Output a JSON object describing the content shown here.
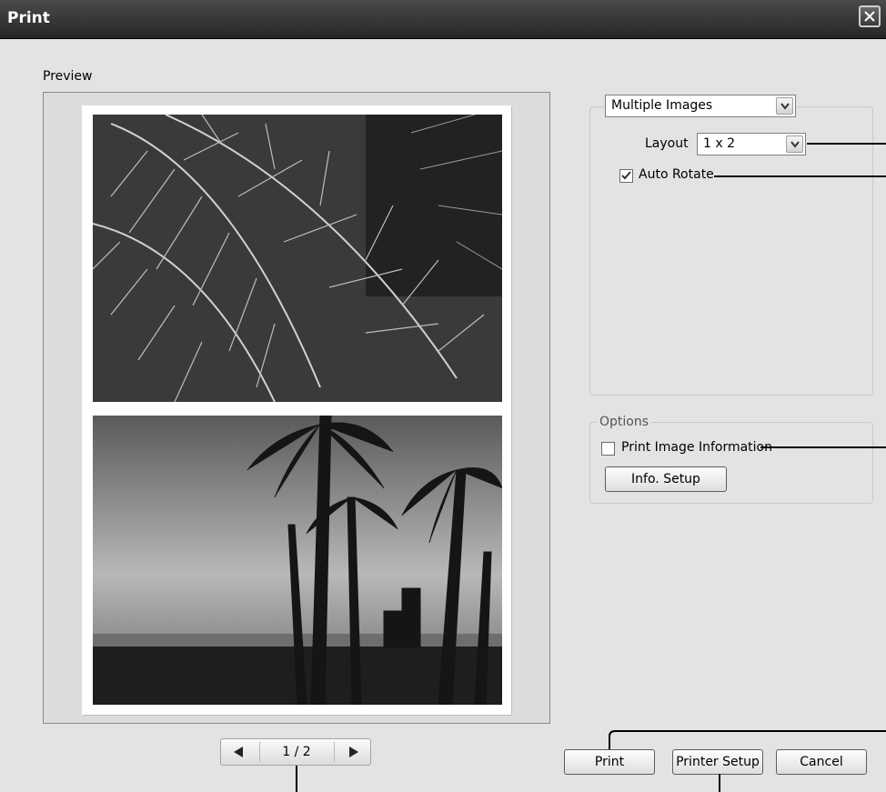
{
  "window": {
    "title": "Print"
  },
  "preview": {
    "label": "Preview"
  },
  "print_mode": {
    "selected": "Multiple Images"
  },
  "layout": {
    "label": "Layout",
    "selected": "1 x 2"
  },
  "auto_rotate": {
    "label": "Auto Rotate",
    "checked": true
  },
  "options": {
    "legend": "Options",
    "print_image_info_label": "Print Image Information",
    "print_image_info_checked": false,
    "info_setup_label": "Info. Setup"
  },
  "pager": {
    "page_text": "1 / 2"
  },
  "buttons": {
    "print": "Print",
    "printer_setup": "Printer Setup",
    "cancel": "Cancel"
  },
  "images": {
    "top": "palm-fronds-photo",
    "bottom": "beach-sunset-palms-photo"
  }
}
